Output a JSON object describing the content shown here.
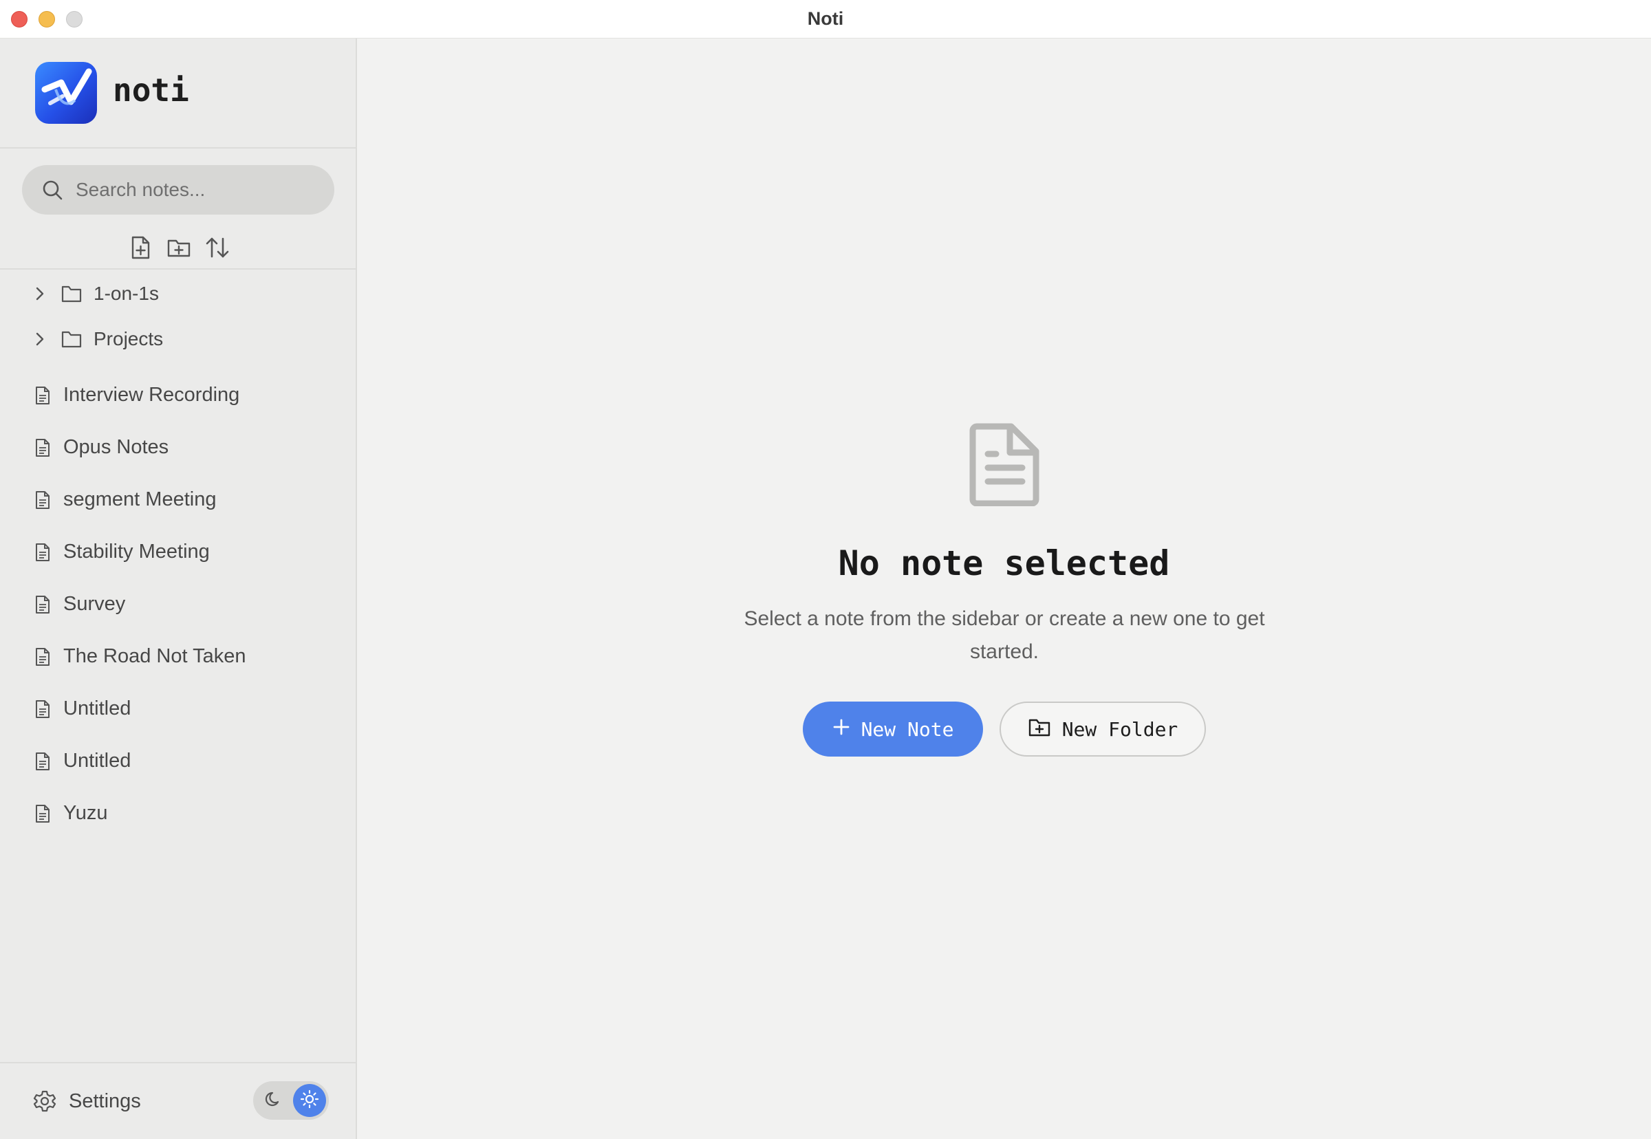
{
  "window": {
    "title": "Noti"
  },
  "sidebar": {
    "brand": {
      "name": "noti"
    },
    "search": {
      "placeholder": "Search notes...",
      "value": ""
    },
    "toolbar": {
      "icons": [
        "new-note-icon",
        "new-folder-icon",
        "sort-icon"
      ]
    },
    "folders": [
      {
        "label": "1-on-1s",
        "expanded": false
      },
      {
        "label": "Projects",
        "expanded": false
      }
    ],
    "notes": [
      {
        "label": "Interview Recording"
      },
      {
        "label": "Opus Notes"
      },
      {
        "label": "segment Meeting"
      },
      {
        "label": "Stability Meeting"
      },
      {
        "label": "Survey"
      },
      {
        "label": "The Road Not Taken"
      },
      {
        "label": "Untitled"
      },
      {
        "label": "Untitled"
      },
      {
        "label": "Yuzu"
      }
    ],
    "footer": {
      "settings_label": "Settings",
      "theme": "light"
    }
  },
  "main": {
    "empty_state": {
      "title": "No note selected",
      "description": "Select a note from the sidebar or create a new one to get started.",
      "new_note_label": "New Note",
      "new_folder_label": "New Folder"
    }
  },
  "colors": {
    "accent": "#4f82ea",
    "sidebar_bg": "#ebebea",
    "main_bg": "#f2f2f1",
    "close": "#ee5f57",
    "minimize": "#f5bd4f"
  }
}
